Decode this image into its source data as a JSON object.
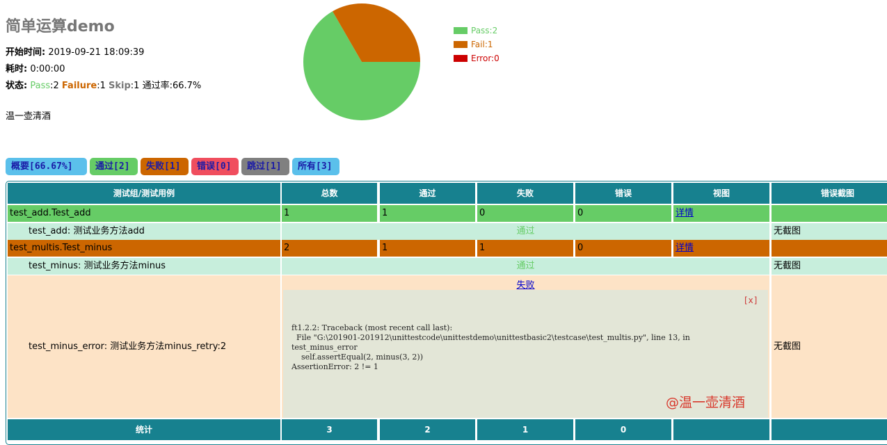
{
  "report": {
    "title": "简单运算demo",
    "start_label": "开始时间:",
    "start_value": "2019-09-21 18:09:39",
    "duration_label": "耗时:",
    "duration_value": "0:00:00",
    "status_label": "状态:",
    "status_pass_label": "Pass",
    "status_pass_value": ":2",
    "status_fail_label": "Failure",
    "status_fail_value": ":1",
    "status_skip_label": "Skip",
    "status_skip_value": ":1",
    "status_rate": "通过率:66.7%",
    "author": "温一壶清酒"
  },
  "chart_data": {
    "type": "pie",
    "labels": [
      "Pass:2",
      "Fail:1",
      "Error:0"
    ],
    "values": [
      2,
      1,
      0
    ],
    "colors": [
      "#66cc66",
      "#cc6600",
      "#cc0000"
    ]
  },
  "legend": [
    {
      "label": "Pass:2",
      "color": "#66cc66",
      "text_color": "#66cc66"
    },
    {
      "label": "Fail:1",
      "color": "#cc6600",
      "text_color": "#cc6600"
    },
    {
      "label": "Error:0",
      "color": "#cc0000",
      "text_color": "#cc0000"
    }
  ],
  "tabs": [
    {
      "label": "概要[66.67%]",
      "bg": "#5bc0eb"
    },
    {
      "label": "通过[2]",
      "bg": "#66cc66"
    },
    {
      "label": "失败[1]",
      "bg": "#cc6600"
    },
    {
      "label": "错误[0]",
      "bg": "#f04e5e"
    },
    {
      "label": "跳过[1]",
      "bg": "#808080"
    },
    {
      "label": "所有[3]",
      "bg": "#5bc0eb"
    }
  ],
  "table": {
    "headers": [
      "测试组/测试用例",
      "总数",
      "通过",
      "失败",
      "错误",
      "视图",
      "错误截图"
    ],
    "rows": {
      "g1": {
        "name": "test_add.Test_add",
        "total": "1",
        "pass": "1",
        "fail": "0",
        "error": "0",
        "view": "详情"
      },
      "c1": {
        "name": "test_add: 测试业务方法add",
        "result": "通过",
        "screenshot": "无截图"
      },
      "g2": {
        "name": "test_multis.Test_minus",
        "total": "2",
        "pass": "1",
        "fail": "1",
        "error": "0",
        "view": "详情"
      },
      "c2": {
        "name": "test_minus: 测试业务方法minus",
        "result": "通过",
        "screenshot": "无截图"
      },
      "c3": {
        "name": "test_minus_error: 测试业务方法minus_retry:2",
        "result": "失败",
        "close": "[x]",
        "trace": "ft1.2.2: Traceback (most recent call last):\n  File \"G:\\201901-201912\\unittestcode\\unittestdemo\\unittestbasic2\\testcase\\test_multis.py\", line 13, in\ntest_minus_error\n    self.assertEqual(2, minus(3, 2))\nAssertionError: 2 != 1",
        "screenshot": "无截图"
      }
    },
    "footer": {
      "label": "统计",
      "total": "3",
      "pass": "2",
      "fail": "1",
      "error": "0"
    }
  },
  "watermark": "@温一壶清酒"
}
